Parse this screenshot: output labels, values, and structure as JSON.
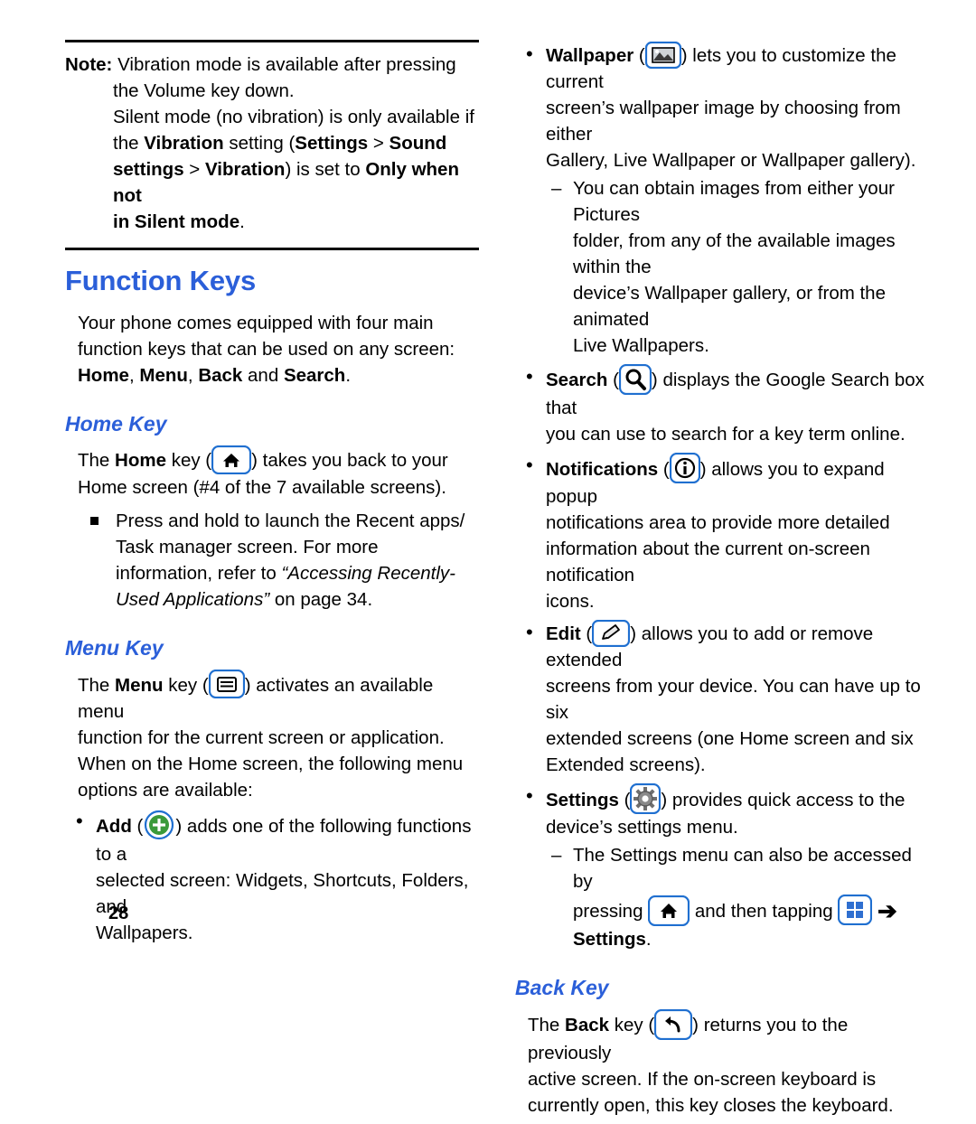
{
  "page": {
    "number": "28"
  },
  "note": {
    "label": "Note:",
    "line1": "Vibration mode is available after pressing",
    "line2": "the Volume key down.",
    "line3": "Silent mode (no vibration) is only available if",
    "line4_a": "the ",
    "line4_b": "Vibration",
    "line4_c": " setting (",
    "line4_d": "Settings",
    "line4_e": " > ",
    "line4_f": "Sound",
    "line5_a": "settings",
    "line5_b": " > ",
    "line5_c": "Vibration",
    "line5_d": ") is set to ",
    "line5_e": "Only when not",
    "line6_a": "in Silent mode",
    "line6_b": "."
  },
  "left": {
    "section_title": "Function Keys",
    "intro_1": "Your phone comes equipped with four main",
    "intro_2": "function keys that can be used on any screen:",
    "intro_keys": [
      "Home",
      "Menu",
      "Back",
      "Search"
    ],
    "intro_sep1": ", ",
    "intro_sep2": " and ",
    "intro_end": ".",
    "home_key": {
      "heading": "Home Key",
      "p1_a": "The ",
      "p1_b": "Home",
      "p1_c": " key (",
      "icon": "home-icon",
      "p1_d": ") takes you back to your",
      "p1_e": "Home screen (#4 of the 7 available screens).",
      "bullet_1": "Press and hold to launch the Recent apps/",
      "bullet_2": "Task manager screen. For more",
      "bullet_3": "information, refer to ",
      "bullet_italic": "“Accessing Recently-",
      "bullet_italic_2": "Used Applications”",
      "bullet_4": " on page 34."
    },
    "menu_key": {
      "heading": "Menu Key",
      "p1_a": "The ",
      "p1_b": "Menu",
      "p1_c": " key (",
      "icon": "menu-icon",
      "p1_d": ") activates an available menu",
      "p1_e": "function for the current screen or application.",
      "p1_f": "When on the Home screen, the following menu",
      "p1_g": "options are available:",
      "add_bullet": {
        "label": "Add",
        "open": " (",
        "icon": "add-icon",
        "close": ") adds one of the following functions to a",
        "line2": "selected screen: Widgets, Shortcuts, Folders, and",
        "line3": "Wallpapers."
      }
    }
  },
  "right": {
    "wallpaper": {
      "label": "Wallpaper",
      "open": " (",
      "icon": "wallpaper-icon",
      "close": ") lets you to customize the current",
      "line2": "screen’s wallpaper image by choosing from either",
      "line3": "Gallery, Live Wallpaper or Wallpaper gallery).",
      "sub1": "You can obtain images from either your Pictures",
      "sub2": "folder, from any of the available images within the",
      "sub3": "device’s Wallpaper gallery, or from the animated",
      "sub4": "Live Wallpapers."
    },
    "search": {
      "label": "Search",
      "open": " (",
      "icon": "search-icon",
      "close": ") displays the Google Search box that",
      "line2": "you can use to search for a key term online."
    },
    "notifications": {
      "label": "Notifications",
      "open": " (",
      "icon": "notifications-icon",
      "close": ") allows you to expand popup",
      "line2": "notifications area to provide more detailed",
      "line3": "information about the current on-screen notification",
      "line4": "icons."
    },
    "edit": {
      "label": "Edit",
      "open": " (",
      "icon": "edit-icon",
      "close": ") allows you to add or remove extended",
      "line2": "screens from your device. You can have up to six",
      "line3": "extended screens (one Home screen and six",
      "line4": "Extended screens)."
    },
    "settings": {
      "label": "Settings",
      "open": " (",
      "icon": "settings-gear-icon",
      "close": ") provides quick access to the",
      "line2": "device’s settings menu.",
      "sub1": "The Settings menu can also be accessed by",
      "sub2_a": "pressing ",
      "sub2_icon": "home-icon",
      "sub2_b": " and then tapping ",
      "sub2_icon2": "apps-grid-icon",
      "sub2_arrow": "➔",
      "sub3_a": "Settings",
      "sub3_b": "."
    },
    "back_key": {
      "heading": "Back Key",
      "p1_a": "The ",
      "p1_b": "Back",
      "p1_c": " key (",
      "icon": "back-icon",
      "p1_d": ") returns you to the previously",
      "line2": "active screen. If the on-screen keyboard is",
      "line3": "currently open, this key closes the keyboard."
    }
  },
  "colors": {
    "heading_blue": "#2b5fd9",
    "icon_blue": "#2f6fd0",
    "icon_green": "#3a9a3a",
    "text": "#000000"
  }
}
